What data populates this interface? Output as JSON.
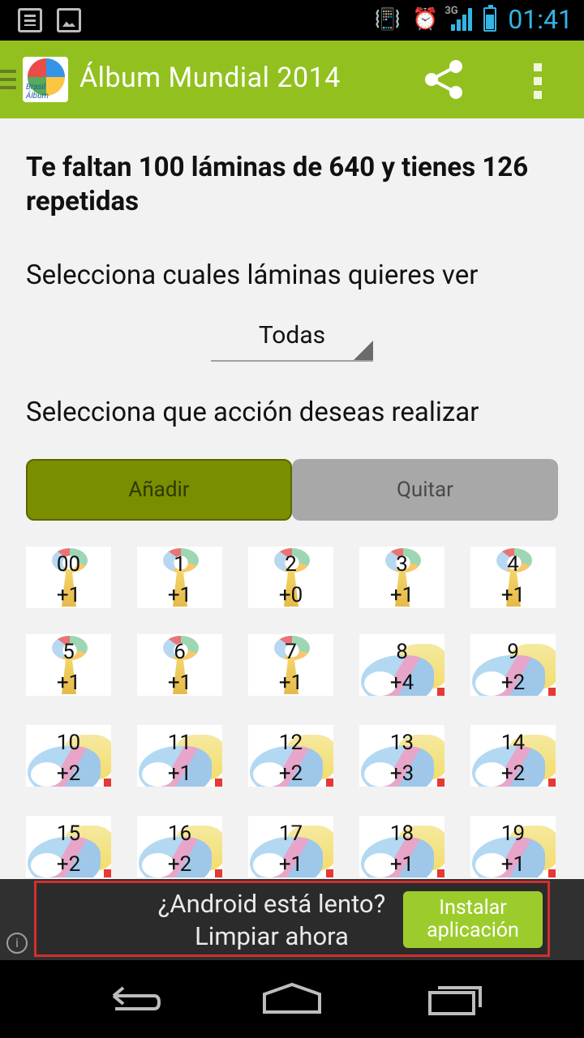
{
  "status_bar": {
    "network": "3G",
    "time": "01:41"
  },
  "action_bar": {
    "title": "Álbum Mundial 2014",
    "logo_text": "Brasil Álbum"
  },
  "summary": "Te faltan 100 láminas de 640 y tienes 126 repetidas",
  "filter": {
    "label": "Selecciona cuales láminas quieres ver",
    "selected": "Todas"
  },
  "action": {
    "label": "Selecciona que acción deseas realizar",
    "add_label": "Añadir",
    "remove_label": "Quitar",
    "selected": "Añadir"
  },
  "stickers": [
    {
      "num": "00",
      "count": "+1",
      "art": "trophy"
    },
    {
      "num": "1",
      "count": "+1",
      "art": "trophy"
    },
    {
      "num": "2",
      "count": "+0",
      "art": "trophy"
    },
    {
      "num": "3",
      "count": "+1",
      "art": "trophy"
    },
    {
      "num": "4",
      "count": "+1",
      "art": "trophy"
    },
    {
      "num": "5",
      "count": "+1",
      "art": "trophy"
    },
    {
      "num": "6",
      "count": "+1",
      "art": "trophy"
    },
    {
      "num": "7",
      "count": "+1",
      "art": "trophy"
    },
    {
      "num": "8",
      "count": "+4",
      "art": "emblem"
    },
    {
      "num": "9",
      "count": "+2",
      "art": "emblem"
    },
    {
      "num": "10",
      "count": "+2",
      "art": "emblem"
    },
    {
      "num": "11",
      "count": "+1",
      "art": "emblem"
    },
    {
      "num": "12",
      "count": "+2",
      "art": "emblem"
    },
    {
      "num": "13",
      "count": "+3",
      "art": "emblem"
    },
    {
      "num": "14",
      "count": "+2",
      "art": "emblem"
    },
    {
      "num": "15",
      "count": "+2",
      "art": "emblem"
    },
    {
      "num": "16",
      "count": "+2",
      "art": "emblem"
    },
    {
      "num": "17",
      "count": "+1",
      "art": "emblem"
    },
    {
      "num": "18",
      "count": "+1",
      "art": "emblem"
    },
    {
      "num": "19",
      "count": "+1",
      "art": "emblem"
    }
  ],
  "ad": {
    "line1": "¿Android está lento?",
    "line2": "Limpiar ahora",
    "cta_line1": "Instalar",
    "cta_line2": "aplicación"
  },
  "colors": {
    "action_bar": "#92c11f",
    "add_button": "#7b8e00",
    "remove_button": "#a8a8a8",
    "clock": "#33b5e5"
  }
}
